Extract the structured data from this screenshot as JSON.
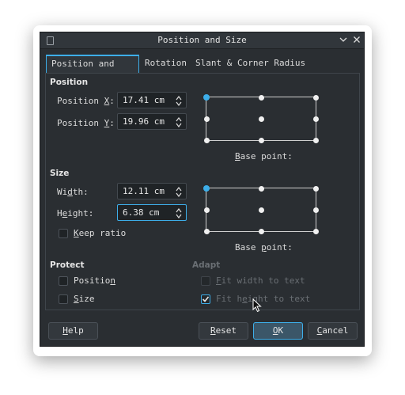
{
  "window": {
    "title": "Position and Size"
  },
  "tabs": [
    {
      "label": "Position and Size",
      "active": true
    },
    {
      "label": "Rotation",
      "active": false
    },
    {
      "label": "Slant & Corner Radius",
      "active": false
    }
  ],
  "position": {
    "heading": "Position",
    "x_label_pre": "Position ",
    "x_label_key": "X",
    "x_label_post": ":",
    "x_value": "17.41 cm",
    "y_label_pre": "Position ",
    "y_label_key": "Y",
    "y_label_post": ":",
    "y_value": "19.96 cm",
    "base_point_key": "B",
    "base_point_rest": "ase point:"
  },
  "size": {
    "heading": "Size",
    "width_label_pre": "Wi",
    "width_label_key": "d",
    "width_label_post": "th:",
    "width_value": "12.11 cm",
    "height_label_pre": "H",
    "height_label_key": "e",
    "height_label_post": "ight:",
    "height_value": "6.38 cm",
    "keep_ratio_key": "K",
    "keep_ratio_rest": "eep ratio",
    "keep_ratio_checked": false,
    "base_point_pre": "Base ",
    "base_point_key": "p",
    "base_point_post": "oint:"
  },
  "protect": {
    "heading": "Protect",
    "position_pre": "Positio",
    "position_key": "n",
    "position_checked": false,
    "size_key": "S",
    "size_rest": "ize",
    "size_checked": false
  },
  "adapt": {
    "heading": "Adapt",
    "fit_width_key": "F",
    "fit_width_rest": "it width to text",
    "fit_width_checked": false,
    "fit_height_pre": "Fit h",
    "fit_height_key": "e",
    "fit_height_post": "ight to text",
    "fit_height_checked": true
  },
  "buttons": {
    "help_key": "H",
    "help_rest": "elp",
    "reset_key": "R",
    "reset_rest": "eset",
    "ok_key": "O",
    "ok_rest": "K",
    "cancel_key": "C",
    "cancel_rest": "ancel"
  },
  "icons": {
    "close": "close-icon",
    "collapse": "chevron-down-icon",
    "app": "app-icon",
    "spin_up": "arrow-up-icon",
    "spin_down": "arrow-down-icon",
    "cursor": "mouse-cursor-icon"
  },
  "colors": {
    "accent": "#3daee9",
    "background": "#2a2e32",
    "text": "#dcdcdc",
    "disabled": "#6a6f74"
  },
  "base_point_selection": {
    "position": "top-left",
    "size": "top-left"
  }
}
